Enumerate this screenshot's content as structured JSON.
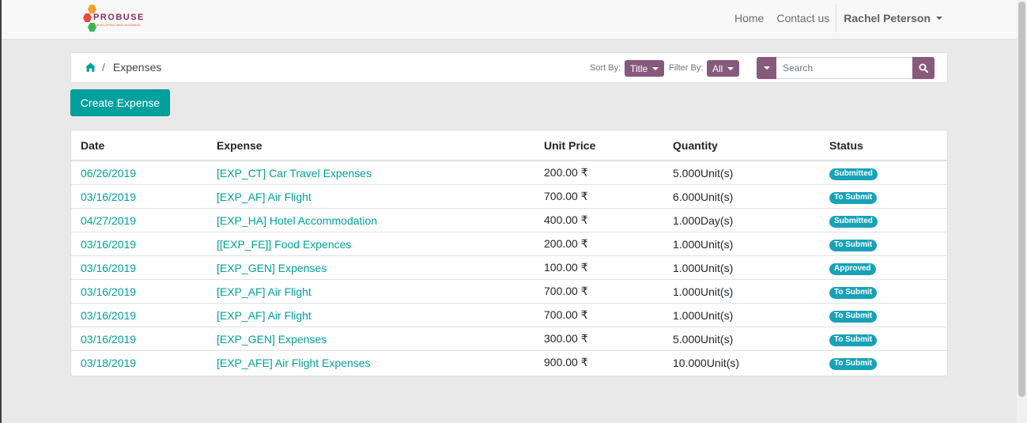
{
  "nav": {
    "brand_word": "PROBUSE",
    "brand_tagline": "DEVELOPING NEW BUSINESS",
    "home": "Home",
    "contact": "Contact us",
    "user": "Rachel Peterson"
  },
  "breadcrumb": {
    "current": "Expenses"
  },
  "toolbar": {
    "sort_label": "Sort By:",
    "sort_value": "Title",
    "filter_label": "Filter By:",
    "filter_value": "All",
    "search_placeholder": "Search"
  },
  "create_button": "Create Expense",
  "table": {
    "headers": [
      "Date",
      "Expense",
      "Unit Price",
      "Quantity",
      "Status"
    ],
    "rows": [
      {
        "date": "06/26/2019",
        "expense": "[EXP_CT] Car Travel Expenses",
        "price": "200.00 ₹",
        "qty": "5.000Unit(s)",
        "status": "Submitted"
      },
      {
        "date": "03/16/2019",
        "expense": "[EXP_AF] Air Flight",
        "price": "700.00 ₹",
        "qty": "6.000Unit(s)",
        "status": "To Submit"
      },
      {
        "date": "04/27/2019",
        "expense": "[EXP_HA] Hotel Accommodation",
        "price": "400.00 ₹",
        "qty": "1.000Day(s)",
        "status": "Submitted"
      },
      {
        "date": "03/16/2019",
        "expense": "[[EXP_FE]] Food Expences",
        "price": "200.00 ₹",
        "qty": "1.000Unit(s)",
        "status": "To Submit"
      },
      {
        "date": "03/16/2019",
        "expense": "[EXP_GEN] Expenses",
        "price": "100.00 ₹",
        "qty": "1.000Unit(s)",
        "status": "Approved"
      },
      {
        "date": "03/16/2019",
        "expense": "[EXP_AF] Air Flight",
        "price": "700.00 ₹",
        "qty": "1.000Unit(s)",
        "status": "To Submit"
      },
      {
        "date": "03/16/2019",
        "expense": "[EXP_AF] Air Flight",
        "price": "700.00 ₹",
        "qty": "1.000Unit(s)",
        "status": "To Submit"
      },
      {
        "date": "03/16/2019",
        "expense": "[EXP_GEN] Expenses",
        "price": "300.00 ₹",
        "qty": "5.000Unit(s)",
        "status": "To Submit"
      },
      {
        "date": "03/18/2019",
        "expense": "[EXP_AFE] Air Flight Expenses",
        "price": "900.00 ₹",
        "qty": "10.000Unit(s)",
        "status": "To Submit"
      }
    ]
  },
  "colors": {
    "accent": "#00a09d",
    "brand_purple": "#875a7b",
    "badge": "#17a2b8"
  }
}
